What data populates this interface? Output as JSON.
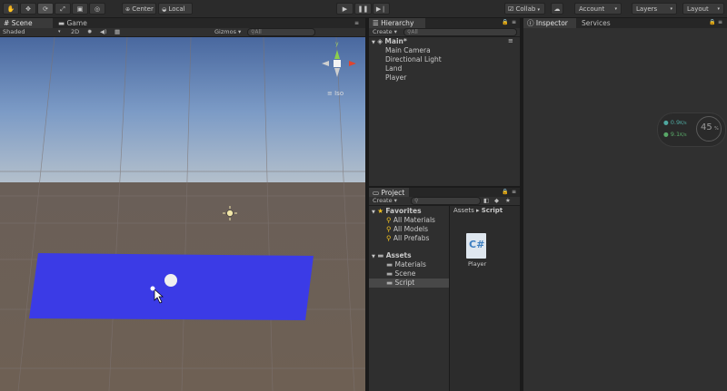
{
  "toolbar": {
    "tools": [
      "hand-tool",
      "move-tool",
      "rotate-tool",
      "scale-tool",
      "rect-tool",
      "transform-tool"
    ],
    "pivot_label": "Center",
    "space_label": "Local",
    "collab_label": "Collab",
    "account_label": "Account",
    "layers_label": "Layers",
    "layout_label": "Layout"
  },
  "scene": {
    "tabs": [
      "Scene",
      "Game"
    ],
    "shading_mode": "Shaded",
    "mode_2d": "2D",
    "gizmos_label": "Gizmos",
    "search_placeholder": "All",
    "axis_y": "y",
    "projection_label": "Iso",
    "sky_color": "#5d7fb8",
    "ground_color": "#6c5f55",
    "plane_color": "#3838e0"
  },
  "hierarchy": {
    "tab": "Hierarchy",
    "create_label": "Create",
    "search_placeholder": "All",
    "scene_name": "Main*",
    "items": [
      "Main Camera",
      "Directional Light",
      "Land",
      "Player"
    ]
  },
  "project": {
    "tab": "Project",
    "create_label": "Create",
    "favorites_label": "Favorites",
    "favorites": [
      "All Materials",
      "All Models",
      "All Prefabs"
    ],
    "assets_label": "Assets",
    "folders": [
      "Materials",
      "Scene",
      "Script"
    ],
    "breadcrumb": [
      "Assets",
      "Script"
    ],
    "files": [
      {
        "name": "Player",
        "type": "C#"
      }
    ]
  },
  "inspector": {
    "tabs": [
      "Inspector",
      "Services"
    ],
    "stats": {
      "up": "0.9",
      "down": "9.1",
      "unit": "K/s",
      "percent": "45"
    }
  }
}
